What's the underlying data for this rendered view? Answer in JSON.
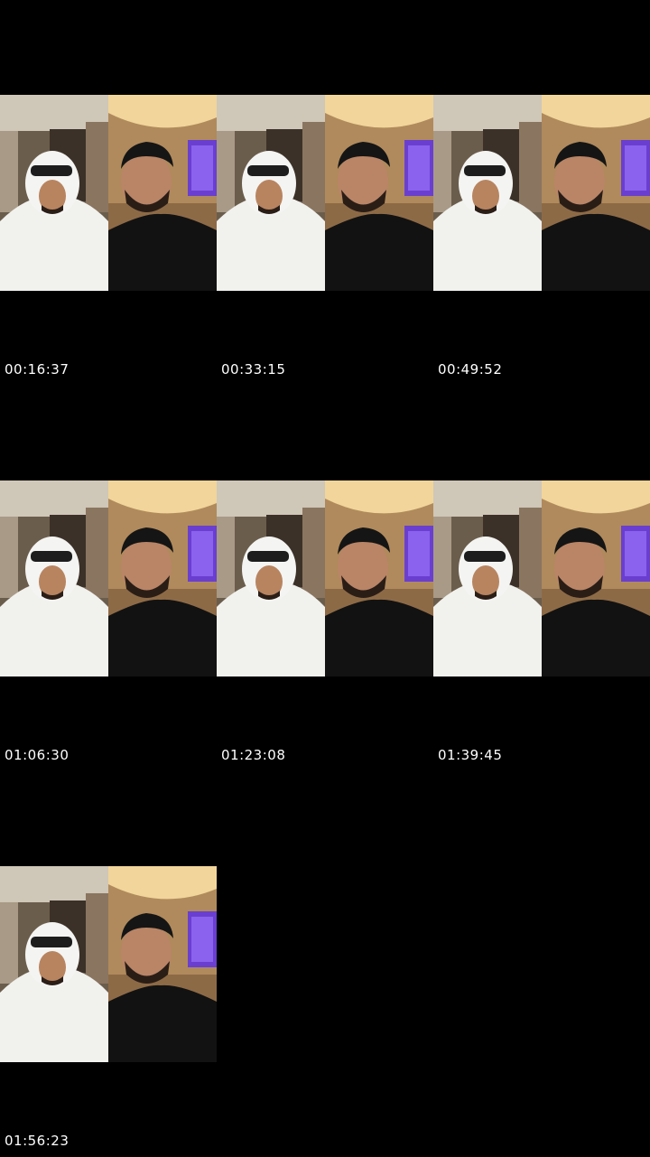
{
  "frames": [
    {
      "timestamp": "00:16:37"
    },
    {
      "timestamp": "00:33:15"
    },
    {
      "timestamp": "00:49:52"
    },
    {
      "timestamp": "01:06:30"
    },
    {
      "timestamp": "01:23:08"
    },
    {
      "timestamp": "01:39:45"
    },
    {
      "timestamp": "01:56:23"
    }
  ],
  "colors": {
    "background": "#000000",
    "timestamp_text": "#ffffff"
  }
}
